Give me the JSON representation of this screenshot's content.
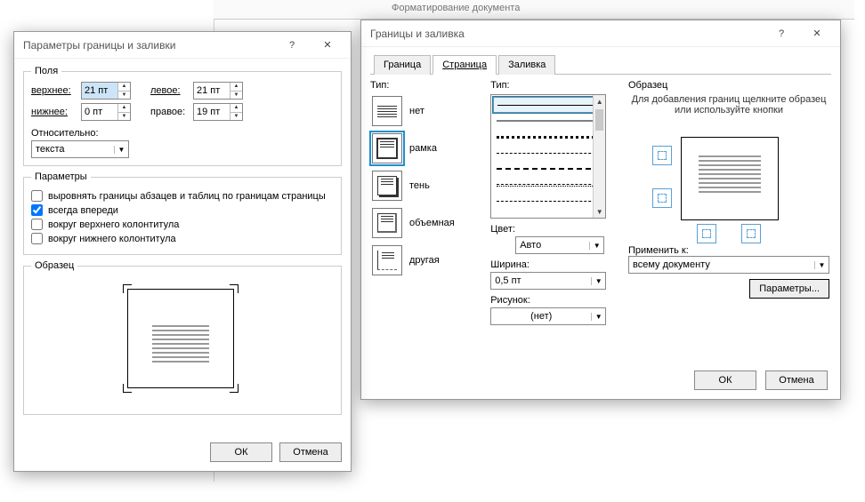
{
  "ribbon": {
    "group_label": "Форматирование документа"
  },
  "dlgA": {
    "title": "Параметры границы и заливки",
    "help": "?",
    "close": "✕",
    "fields_group": "Поля",
    "top_lbl": "верхнее:",
    "top_val": "21 пт",
    "left_lbl": "левое:",
    "left_val": "21 пт",
    "bottom_lbl": "нижнее:",
    "bottom_val": "0 пт",
    "right_lbl": "правое:",
    "right_val": "19 пт",
    "relative_lbl": "Относительно:",
    "relative_val": "текста",
    "options_group": "Параметры",
    "cb_align": "выровнять границы абзацев и таблиц по границам страницы",
    "cb_always": "всегда впереди",
    "cb_header": "вокруг верхнего колонтитула",
    "cb_footer": "вокруг нижнего колонтитула",
    "preview_group": "Образец",
    "ok": "ОК",
    "cancel": "Отмена"
  },
  "dlgB": {
    "title": "Границы и заливка",
    "help": "?",
    "close": "✕",
    "tabs": [
      "Граница",
      "Страница",
      "Заливка"
    ],
    "active_tab": 1,
    "colA_label": "Тип:",
    "types": [
      "нет",
      "рамка",
      "тень",
      "объемная",
      "другая"
    ],
    "colB_label": "Тип:",
    "color_lbl": "Цвет:",
    "color_val": "Авто",
    "width_lbl": "Ширина:",
    "width_val": "0,5 пт",
    "art_lbl": "Рисунок:",
    "art_val": "(нет)",
    "colC_label": "Образец",
    "hint": "Для добавления границ щелкните образец или используйте кнопки",
    "apply_lbl": "Применить к:",
    "apply_val": "всему документу",
    "params_btn": "Параметры...",
    "ok": "ОК",
    "cancel": "Отмена"
  }
}
